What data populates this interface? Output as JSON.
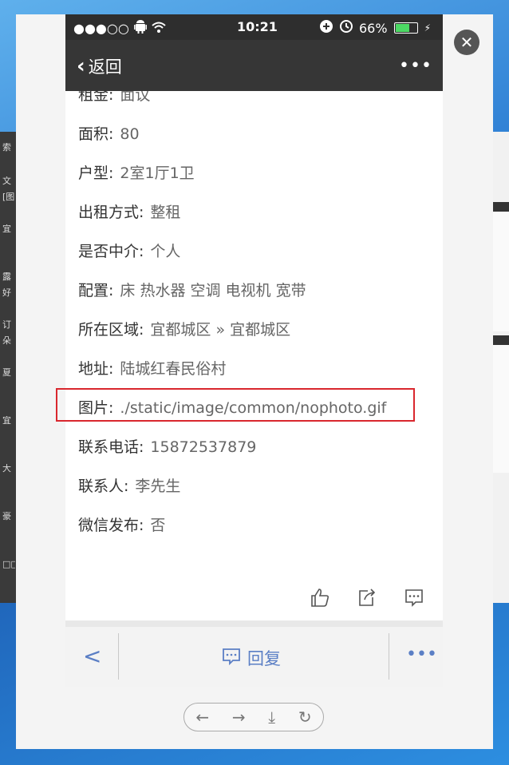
{
  "desktop": {
    "left_fragments": [
      "索",
      "文",
      "[图",
      "宜",
      "露",
      "好",
      "订",
      "朵",
      "夏",
      "宜",
      "大",
      "豪",
      "□□"
    ]
  },
  "window": {
    "close_icon": "close-icon"
  },
  "status_bar": {
    "signal": "●●●○○",
    "time": "10:21",
    "battery_percent": "66%"
  },
  "nav": {
    "back_label": "返回",
    "more_label": "•••"
  },
  "details": [
    {
      "key": "租金:",
      "value": "面议"
    },
    {
      "key": "面积:",
      "value": "80"
    },
    {
      "key": "户型:",
      "value": "2室1厅1卫"
    },
    {
      "key": "出租方式:",
      "value": "整租"
    },
    {
      "key": "是否中介:",
      "value": "个人"
    },
    {
      "key": "配置:",
      "value": "床 热水器 空调 电视机 宽带"
    },
    {
      "key": "所在区域:",
      "value": "宜都城区 » 宜都城区"
    },
    {
      "key": "地址:",
      "value": "陆城红春民俗村"
    },
    {
      "key": "图片:",
      "value": "./static/image/common/nophoto.gif"
    },
    {
      "key": "联系电话:",
      "value": "15872537879"
    },
    {
      "key": "联系人:",
      "value": "李先生"
    },
    {
      "key": "微信发布:",
      "value": "否"
    }
  ],
  "bottom_bar": {
    "back": "<",
    "reply_label": "回复",
    "more": "•••"
  },
  "browser_nav": {
    "back": "←",
    "forward": "→",
    "download": "⤓",
    "refresh": "↻"
  },
  "colors": {
    "highlight": "#d9272e",
    "accent": "#5b7fc5",
    "nav_bg": "#363636"
  }
}
